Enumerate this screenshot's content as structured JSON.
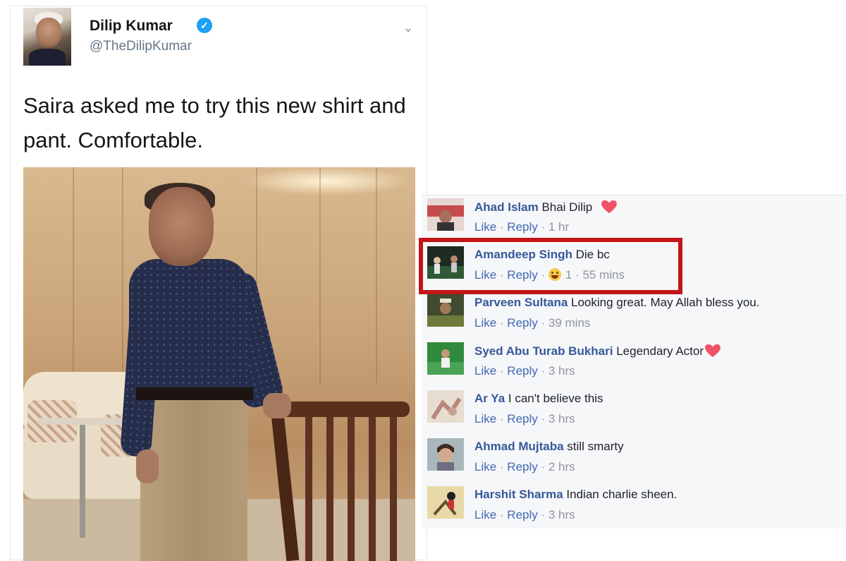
{
  "tweet": {
    "name": "Dilip Kumar",
    "handle": "@TheDilipKumar",
    "verified_glyph": "✓",
    "chevron_glyph": "⌄",
    "text": "Saira asked me to try this new shirt and pant. Comfortable.",
    "photo_icon": "photo-man-standing-by-chair"
  },
  "comments": [
    {
      "name": "Ahad Islam",
      "text": "Bhai Dilip",
      "emoji": "heart-icon",
      "like": "Like",
      "reply": "Reply",
      "sep": " · ",
      "time": "1 hr",
      "avatar_color": "#c44c4a"
    },
    {
      "name": "Amandeep Singh",
      "text": "Die bc",
      "like": "Like",
      "reply": "Reply",
      "sep": " · ",
      "reaction_count": "1",
      "time": "55 mins",
      "avatar_color": "#2d3a2f"
    },
    {
      "name": "Parveen Sultana",
      "text": "Looking great. May Allah bless you.",
      "like": "Like",
      "reply": "Reply",
      "sep": " · ",
      "time": "39 mins",
      "avatar_color": "#3f4a2e"
    },
    {
      "name": "Syed Abu Turab Bukhari",
      "text": "Legendary Actor",
      "emoji": "heart-icon",
      "like": "Like",
      "reply": "Reply",
      "sep": " · ",
      "time": "3 hrs",
      "avatar_color": "#2f8a3c"
    },
    {
      "name": "Ar Ya",
      "text": "I can't believe this",
      "like": "Like",
      "reply": "Reply",
      "sep": " · ",
      "time": "3 hrs",
      "avatar_color": "#d9cbb8"
    },
    {
      "name": "Ahmad Mujtaba",
      "text": "still smarty",
      "like": "Like",
      "reply": "Reply",
      "sep": " · ",
      "time": "2 hrs",
      "avatar_color": "#8a9aa0"
    },
    {
      "name": "Harshit Sharma",
      "text": "Indian charlie sheen.",
      "like": "Like",
      "reply": "Reply",
      "sep": " · ",
      "time": "3 hrs",
      "avatar_color": "#d8c07a"
    }
  ],
  "colors": {
    "link": "#365899",
    "meta": "#90949c",
    "highlight_border": "#c31517",
    "heart": "#f25268"
  }
}
